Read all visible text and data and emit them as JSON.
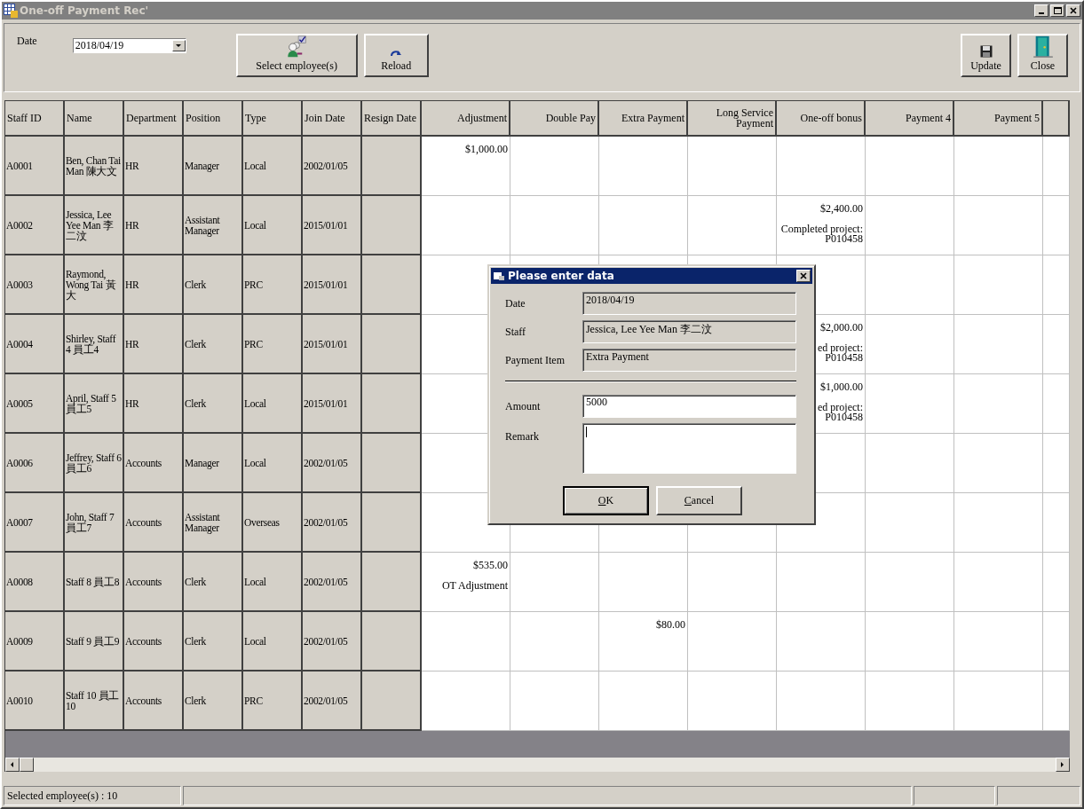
{
  "window": {
    "title": "One-off Payment Rec'"
  },
  "toolbar": {
    "date_label": "Date",
    "date_value": "2018/04/19",
    "buttons": [
      {
        "label": "Select employee(s)",
        "kind": "select"
      },
      {
        "label": "Reload",
        "kind": "reload"
      }
    ],
    "right_buttons": [
      {
        "label": "Update",
        "kind": "save"
      },
      {
        "label": "Close",
        "kind": "door"
      }
    ]
  },
  "table": {
    "info_columns": [
      "Staff ID",
      "Name",
      "Department",
      "Position",
      "Type",
      "Join Date",
      "Resign Date"
    ],
    "payment_columns": [
      "Adjustment",
      "Double Pay",
      "Extra Payment",
      "Long Service Payment",
      "One-off bonus",
      "Payment 4",
      "Payment 5"
    ],
    "rows": [
      {
        "staff_id": "A0001",
        "name": "Ben, Chan Tai Man 陳大文",
        "department": "HR",
        "position": "Manager",
        "type": "Local",
        "join_date": "2002/01/05",
        "payments": {
          "adjustment": {
            "amount": "$1,000.00"
          }
        }
      },
      {
        "staff_id": "A0002",
        "name": "Jessica, Lee Yee Man 李二汶",
        "department": "HR",
        "position": "Assistant Manager",
        "type": "Local",
        "join_date": "2015/01/01",
        "payments": {
          "one_off_bonus": {
            "amount": "$2,400.00",
            "remark": "Completed project: P010458"
          }
        }
      },
      {
        "staff_id": "A0003",
        "name": "Raymond, Wong Tai 黃大",
        "department": "HR",
        "position": "Clerk",
        "type": "PRC",
        "join_date": "2015/01/01"
      },
      {
        "staff_id": "A0004",
        "name": "Shirley, Staff 4 員工4",
        "department": "HR",
        "position": "Clerk",
        "type": "PRC",
        "join_date": "2015/01/01",
        "payments": {
          "one_off_bonus": {
            "amount": "$2,000.00",
            "remark": "ed project: P010458"
          }
        }
      },
      {
        "staff_id": "A0005",
        "name": "April, Staff 5 員工5",
        "department": "HR",
        "position": "Clerk",
        "type": "Local",
        "join_date": "2015/01/01",
        "payments": {
          "one_off_bonus": {
            "amount": "$1,000.00",
            "remark": "ed project: P010458"
          }
        }
      },
      {
        "staff_id": "A0006",
        "name": "Jeffrey, Staff 6 員工6",
        "department": "Accounts",
        "position": "Manager",
        "type": "Local",
        "join_date": "2002/01/05"
      },
      {
        "staff_id": "A0007",
        "name": "John, Staff 7 員工7",
        "department": "Accounts",
        "position": "Assistant Manager",
        "type": "Overseas",
        "join_date": "2002/01/05"
      },
      {
        "staff_id": "A0008",
        "name": "Staff 8 員工8",
        "department": "Accounts",
        "position": "Clerk",
        "type": "Local",
        "join_date": "2002/01/05",
        "payments": {
          "adjustment": {
            "amount": "$535.00",
            "remark": "OT Adjustment"
          }
        }
      },
      {
        "staff_id": "A0009",
        "name": "Staff 9 員工9",
        "department": "Accounts",
        "position": "Clerk",
        "type": "Local",
        "join_date": "2002/01/05",
        "payments": {
          "extra_payment": {
            "amount": "$80.00"
          }
        }
      },
      {
        "staff_id": "A0010",
        "name": "Staff 10 員工10",
        "department": "Accounts",
        "position": "Clerk",
        "type": "PRC",
        "join_date": "2002/01/05"
      }
    ]
  },
  "dialog": {
    "title": "Please enter data",
    "info_fields": [
      {
        "label": "Date",
        "value": "2018/04/19"
      },
      {
        "label": "Staff",
        "value": "Jessica, Lee Yee Man 李二汶"
      },
      {
        "label": "Payment Item",
        "value": "Extra Payment"
      }
    ],
    "amount": {
      "label": "Amount",
      "value": "5000"
    },
    "remark": {
      "label": "Remark"
    },
    "buttons": [
      {
        "label": "OK",
        "default": true,
        "mnemonic": true
      },
      {
        "label": "Cancel",
        "default": false,
        "mnemonic": true
      }
    ]
  },
  "status_bar": {
    "text": "Selected employee(s) : 10"
  }
}
